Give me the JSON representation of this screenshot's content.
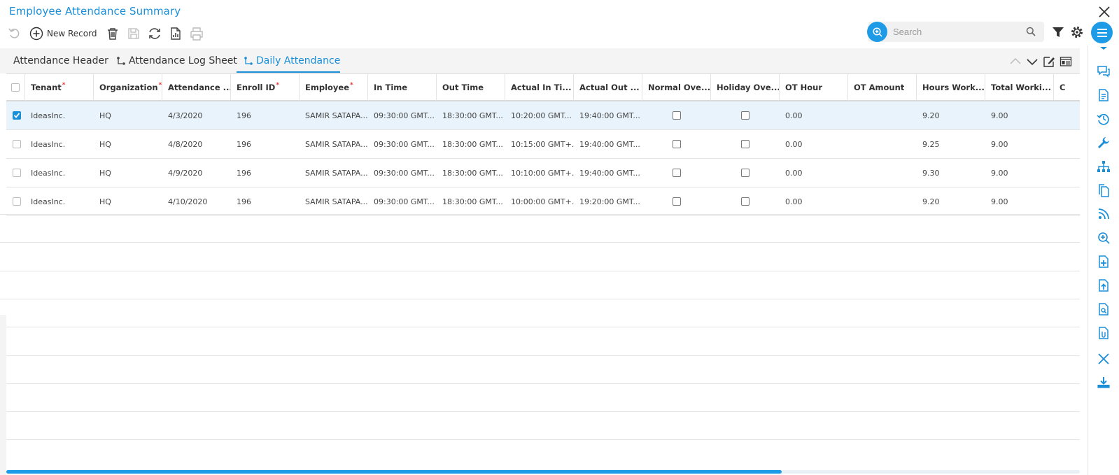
{
  "window": {
    "title": "Employee Attendance Summary"
  },
  "toolbar": {
    "new_record_label": "New Record"
  },
  "search": {
    "placeholder": "Search"
  },
  "tabs": [
    {
      "label": "Attendance Header",
      "icon": "none",
      "active": false
    },
    {
      "label": "Attendance Log Sheet",
      "icon": "link-tree-icon",
      "active": false
    },
    {
      "label": "Daily Attendance",
      "icon": "link-tree-icon",
      "active": true
    }
  ],
  "grid": {
    "columns": [
      {
        "label": "Tenant",
        "required": true
      },
      {
        "label": "Organization",
        "required": true
      },
      {
        "label": "Attendance ...",
        "required": false
      },
      {
        "label": "Enroll ID",
        "required": true
      },
      {
        "label": "Employee",
        "required": true
      },
      {
        "label": "In Time",
        "required": false
      },
      {
        "label": "Out Time",
        "required": false
      },
      {
        "label": "Actual In Ti...",
        "required": false
      },
      {
        "label": "Actual Out ...",
        "required": false
      },
      {
        "label": "Normal Ove...",
        "required": false
      },
      {
        "label": "Holiday Ove...",
        "required": false
      },
      {
        "label": "OT Hour",
        "required": false
      },
      {
        "label": "OT Amount",
        "required": false
      },
      {
        "label": "Hours Work...",
        "required": false
      },
      {
        "label": "Total Worki...",
        "required": false
      },
      {
        "label": "C",
        "required": false
      }
    ],
    "rows": [
      {
        "selected": true,
        "tenant": "IdeasInc.",
        "organization": "HQ",
        "attendance_date": "4/3/2020",
        "enroll_id": "196",
        "employee": "SAMIR SATAPA...",
        "in_time": "09:30:00 GMT...",
        "out_time": "18:30:00 GMT...",
        "actual_in": "10:20:00 GMT...",
        "actual_out": "19:40:00 GMT...",
        "normal_ot": false,
        "holiday_ot": false,
        "ot_hour": "0.00",
        "ot_amount": "",
        "hours_worked": "9.20",
        "total_working": "9.00"
      },
      {
        "selected": false,
        "tenant": "IdeasInc.",
        "organization": "HQ",
        "attendance_date": "4/8/2020",
        "enroll_id": "196",
        "employee": "SAMIR SATAPA...",
        "in_time": "09:30:00 GMT...",
        "out_time": "18:30:00 GMT...",
        "actual_in": "10:15:00 GMT+...",
        "actual_out": "19:40:00 GMT...",
        "normal_ot": false,
        "holiday_ot": false,
        "ot_hour": "0.00",
        "ot_amount": "",
        "hours_worked": "9.25",
        "total_working": "9.00"
      },
      {
        "selected": false,
        "tenant": "IdeasInc.",
        "organization": "HQ",
        "attendance_date": "4/9/2020",
        "enroll_id": "196",
        "employee": "SAMIR SATAPA...",
        "in_time": "09:30:00 GMT...",
        "out_time": "18:30:00 GMT...",
        "actual_in": "10:10:00 GMT+...",
        "actual_out": "19:40:00 GMT...",
        "normal_ot": false,
        "holiday_ot": false,
        "ot_hour": "0.00",
        "ot_amount": "",
        "hours_worked": "9.30",
        "total_working": "9.00"
      },
      {
        "selected": false,
        "tenant": "IdeasInc.",
        "organization": "HQ",
        "attendance_date": "4/10/2020",
        "enroll_id": "196",
        "employee": "SAMIR SATAPA...",
        "in_time": "09:30:00 GMT...",
        "out_time": "18:30:00 GMT...",
        "actual_in": "10:00:00 GMT+...",
        "actual_out": "19:20:00 GMT...",
        "normal_ot": false,
        "holiday_ot": false,
        "ot_hour": "0.00",
        "ot_amount": "",
        "hours_worked": "9.20",
        "total_working": "9.00"
      }
    ]
  },
  "right_rail_icons": [
    "chevron-down-icon",
    "comments-icon",
    "document-icon",
    "history-icon",
    "wrench-icon",
    "hierarchy-icon",
    "copy-icon",
    "rss-icon",
    "zoom-in-icon",
    "add-file-icon",
    "upload-file-icon",
    "file-search-icon",
    "file-attachment-icon",
    "close-icon",
    "download-icon"
  ],
  "colors": {
    "accent": "#1d9be6",
    "link": "#1a8fd8",
    "required": "#e53935",
    "selected_row": "#e8f3fb"
  }
}
